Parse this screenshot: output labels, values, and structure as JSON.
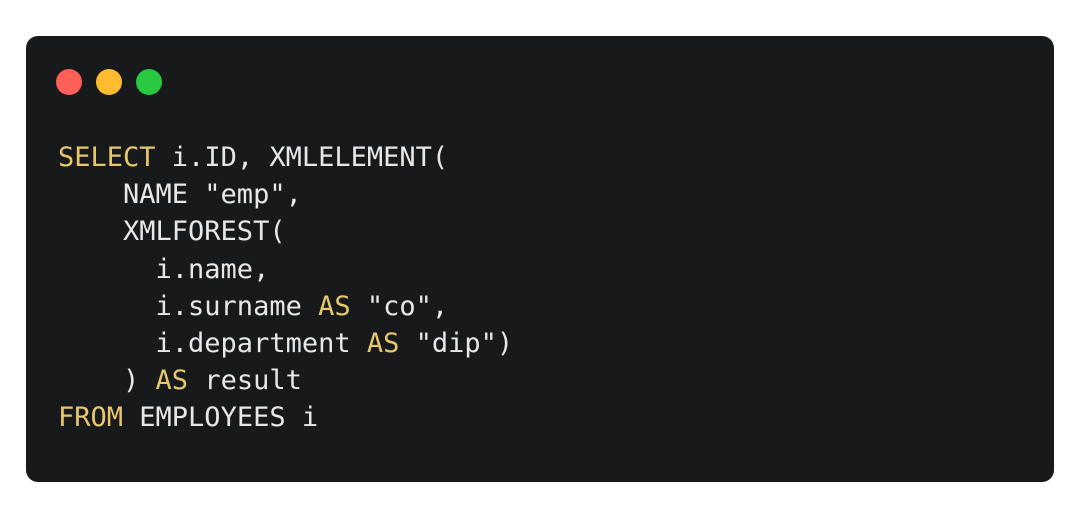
{
  "window": {
    "controls": {
      "close": "close-dot",
      "minimize": "minimize-dot",
      "zoom": "zoom-dot"
    },
    "colors": {
      "background": "#18191b",
      "keyword": "#e7c96b",
      "text": "#e8e8e8",
      "close": "#ff5f57",
      "minimize": "#febc2e",
      "zoom": "#28c840"
    }
  },
  "code": {
    "line1": {
      "kw": "SELECT",
      "rest": " i.ID, XMLELEMENT("
    },
    "line2": {
      "text": "    NAME \"emp\","
    },
    "line3": {
      "text": "    XMLFOREST("
    },
    "line4": {
      "text": "      i.name,"
    },
    "line5": {
      "pre": "      i.surname ",
      "kw": "AS",
      "post": " \"co\","
    },
    "line6": {
      "pre": "      i.department ",
      "kw": "AS",
      "post": " \"dip\")"
    },
    "line7": {
      "pre": "    ) ",
      "kw": "AS",
      "post": " result"
    },
    "line8": {
      "kw": "FROM",
      "rest": " EMPLOYEES i"
    }
  }
}
